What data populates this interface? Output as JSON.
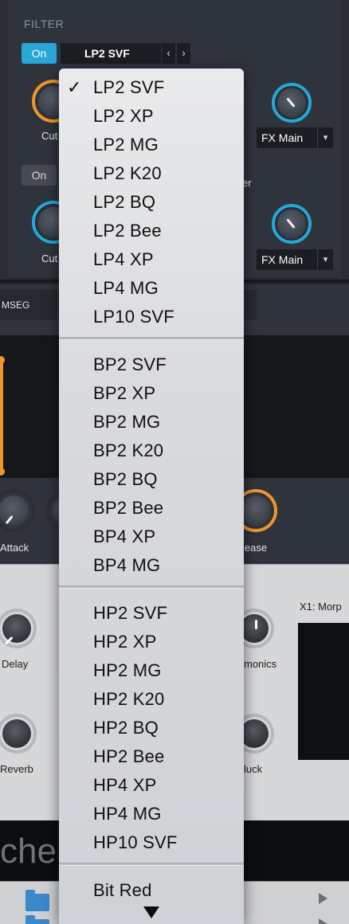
{
  "filter": {
    "title": "FILTER",
    "on1": "On",
    "on2": "On",
    "type": "LP2 SVF",
    "prev": "‹",
    "next": "›",
    "cutoff1": "Cut",
    "cutoff2": "Cut",
    "partial_label": "er",
    "fx1": "FX Main",
    "fx2": "FX Main"
  },
  "mseg": {
    "tab": "MSEG"
  },
  "envelope": {
    "attack": "Attack",
    "release": "lease"
  },
  "fx": {
    "delay": "Delay",
    "reverb": "Reverb",
    "harmonics": "monics",
    "duck": "luck",
    "x1": "X1: Morp"
  },
  "bottom": {
    "text": "che"
  },
  "menu": {
    "selected_check": "✓",
    "groups": [
      [
        "LP2 SVF",
        "LP2 XP",
        "LP2 MG",
        "LP2 K20",
        "LP2 BQ",
        "LP2 Bee",
        "LP4 XP",
        "LP4 MG",
        "LP10 SVF"
      ],
      [
        "BP2 SVF",
        "BP2 XP",
        "BP2 MG",
        "BP2 K20",
        "BP2 BQ",
        "BP2 Bee",
        "BP4 XP",
        "BP4 MG"
      ],
      [
        "HP2 SVF",
        "HP2 XP",
        "HP2 MG",
        "HP2 K20",
        "HP2 BQ",
        "HP2 Bee",
        "HP4 XP",
        "HP4 MG",
        "HP10 SVF"
      ],
      [
        "Bit Red"
      ]
    ]
  },
  "colors": {
    "accent_blue": "#2aa6d6",
    "accent_orange": "#f0952b"
  }
}
